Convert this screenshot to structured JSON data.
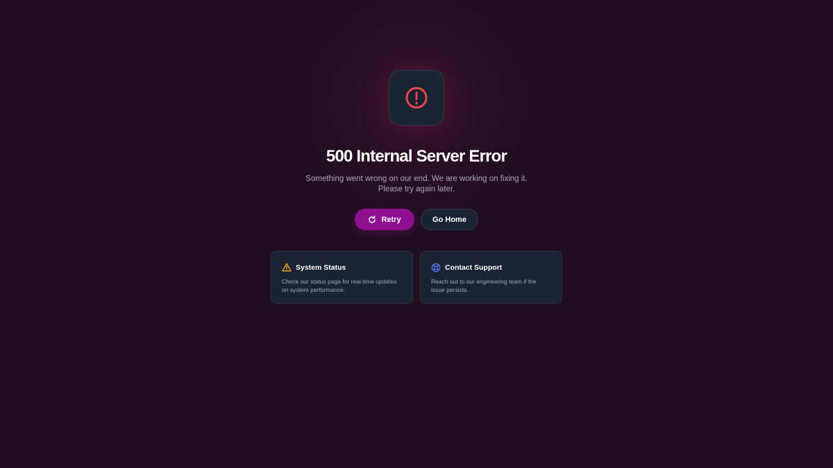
{
  "error": {
    "icon": "alert-circle-icon",
    "title": "500 Internal Server Error",
    "message_line1": "Something went wrong on our end. We are working on fixing it.",
    "message_line2": "Please try again later."
  },
  "actions": {
    "retry_icon": "refresh-icon",
    "retry_label": "Retry",
    "home_label": "Go Home"
  },
  "cards": [
    {
      "icon": "warning-triangle-icon",
      "title": "System Status",
      "text": "Check our status page for real-time updates on system performance."
    },
    {
      "icon": "support-lifebuoy-icon",
      "title": "Contact Support",
      "text": "Reach out to our engineering team if the issue persists."
    }
  ],
  "colors": {
    "background": "#200f20",
    "card": "#1a2233",
    "accent": "#8e0f92",
    "error_red": "#e5484d",
    "warning": "#f5a524",
    "support_blue": "#4f7cf0"
  }
}
